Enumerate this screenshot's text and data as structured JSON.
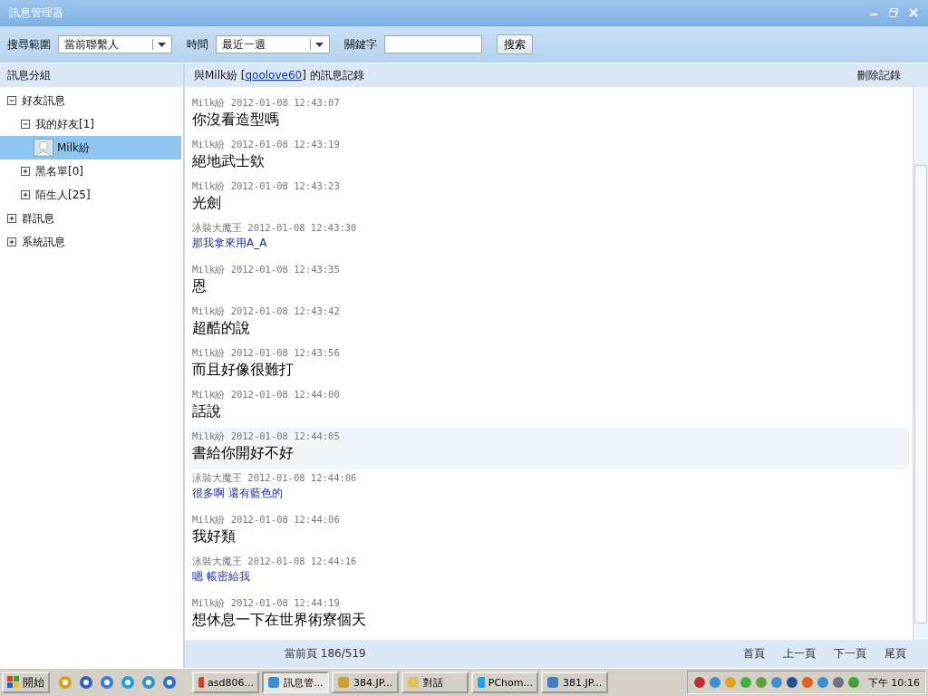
{
  "window": {
    "title": "訊息管理器"
  },
  "search": {
    "scope_label": "搜尋範圍",
    "scope_value": "當前聯繫人",
    "time_label": "時間",
    "time_value": "最近一週",
    "keyword_label": "關鍵字",
    "button": "搜索"
  },
  "sidebar": {
    "title": "訊息分組",
    "items": [
      {
        "label": "好友訊息",
        "expanded": true,
        "selected": false,
        "children": [
          {
            "label": "我的好友[1]",
            "expanded": true,
            "selected": false,
            "children": [
              {
                "label": "Milk紛",
                "kind": "contact",
                "selected": true
              }
            ]
          },
          {
            "label": "黑名單[0]",
            "expanded": false,
            "selected": false
          },
          {
            "label": "陌生人[25]",
            "expanded": false,
            "selected": false
          }
        ]
      },
      {
        "label": "群訊息",
        "expanded": false,
        "selected": false
      },
      {
        "label": "系統訊息",
        "expanded": false,
        "selected": false
      }
    ]
  },
  "history": {
    "title_prefix": "與Milk紛 [",
    "title_link": "qoolove60",
    "title_suffix": "] 的訊息記錄",
    "delete": "刪除記錄",
    "messages": [
      {
        "kind": "friend",
        "sender": "Milk紛",
        "time": "2012-01-08 12:43:07",
        "text": "你沒看造型嗎",
        "selected": false
      },
      {
        "kind": "friend",
        "sender": "Milk紛",
        "time": "2012-01-08 12:43:19",
        "text": "絕地武士欸",
        "selected": false
      },
      {
        "kind": "friend",
        "sender": "Milk紛",
        "time": "2012-01-08 12:43:23",
        "text": "光劍",
        "selected": false
      },
      {
        "kind": "self",
        "sender": "泳裝大魔王",
        "time": "2012-01-08 12:43:30",
        "text": "那我拿來用A_A",
        "selected": false
      },
      {
        "kind": "friend",
        "sender": "Milk紛",
        "time": "2012-01-08 12:43:35",
        "text": "恩",
        "selected": false
      },
      {
        "kind": "friend",
        "sender": "Milk紛",
        "time": "2012-01-08 12:43:42",
        "text": "超酷的說",
        "selected": false
      },
      {
        "kind": "friend",
        "sender": "Milk紛",
        "time": "2012-01-08 12:43:56",
        "text": "而且好像很難打",
        "selected": false
      },
      {
        "kind": "friend",
        "sender": "Milk紛",
        "time": "2012-01-08 12:44:00",
        "text": "話說",
        "selected": false
      },
      {
        "kind": "friend",
        "sender": "Milk紛",
        "time": "2012-01-08 12:44:05",
        "text": "書給你開好不好",
        "selected": true
      },
      {
        "kind": "self",
        "sender": "泳裝大魔王",
        "time": "2012-01-08 12:44:06",
        "text": "很多啊 還有藍色的",
        "selected": false
      },
      {
        "kind": "friend",
        "sender": "Milk紛",
        "time": "2012-01-08 12:44:06",
        "text": "我好類",
        "selected": false
      },
      {
        "kind": "self",
        "sender": "泳裝大魔王",
        "time": "2012-01-08 12:44:16",
        "text": "嗯 帳密給我",
        "selected": false
      },
      {
        "kind": "friend",
        "sender": "Milk紛",
        "time": "2012-01-08 12:44:19",
        "text": "想休息一下在世界術寮個天",
        "selected": false
      }
    ],
    "page": "當前頁 186/519",
    "nav": [
      "首頁",
      "上一頁",
      "下一頁",
      "尾頁"
    ]
  },
  "taskbar": {
    "start": "開始",
    "tasks": [
      {
        "label": "asd806...",
        "selected": false
      },
      {
        "label": "訊息管...",
        "selected": true
      },
      {
        "label": "384.JP...",
        "selected": false
      },
      {
        "label": "對話",
        "selected": false
      },
      {
        "label": "PChom...",
        "selected": false
      },
      {
        "label": "381.JP...",
        "selected": false
      }
    ],
    "clock": "下午 10:16"
  }
}
